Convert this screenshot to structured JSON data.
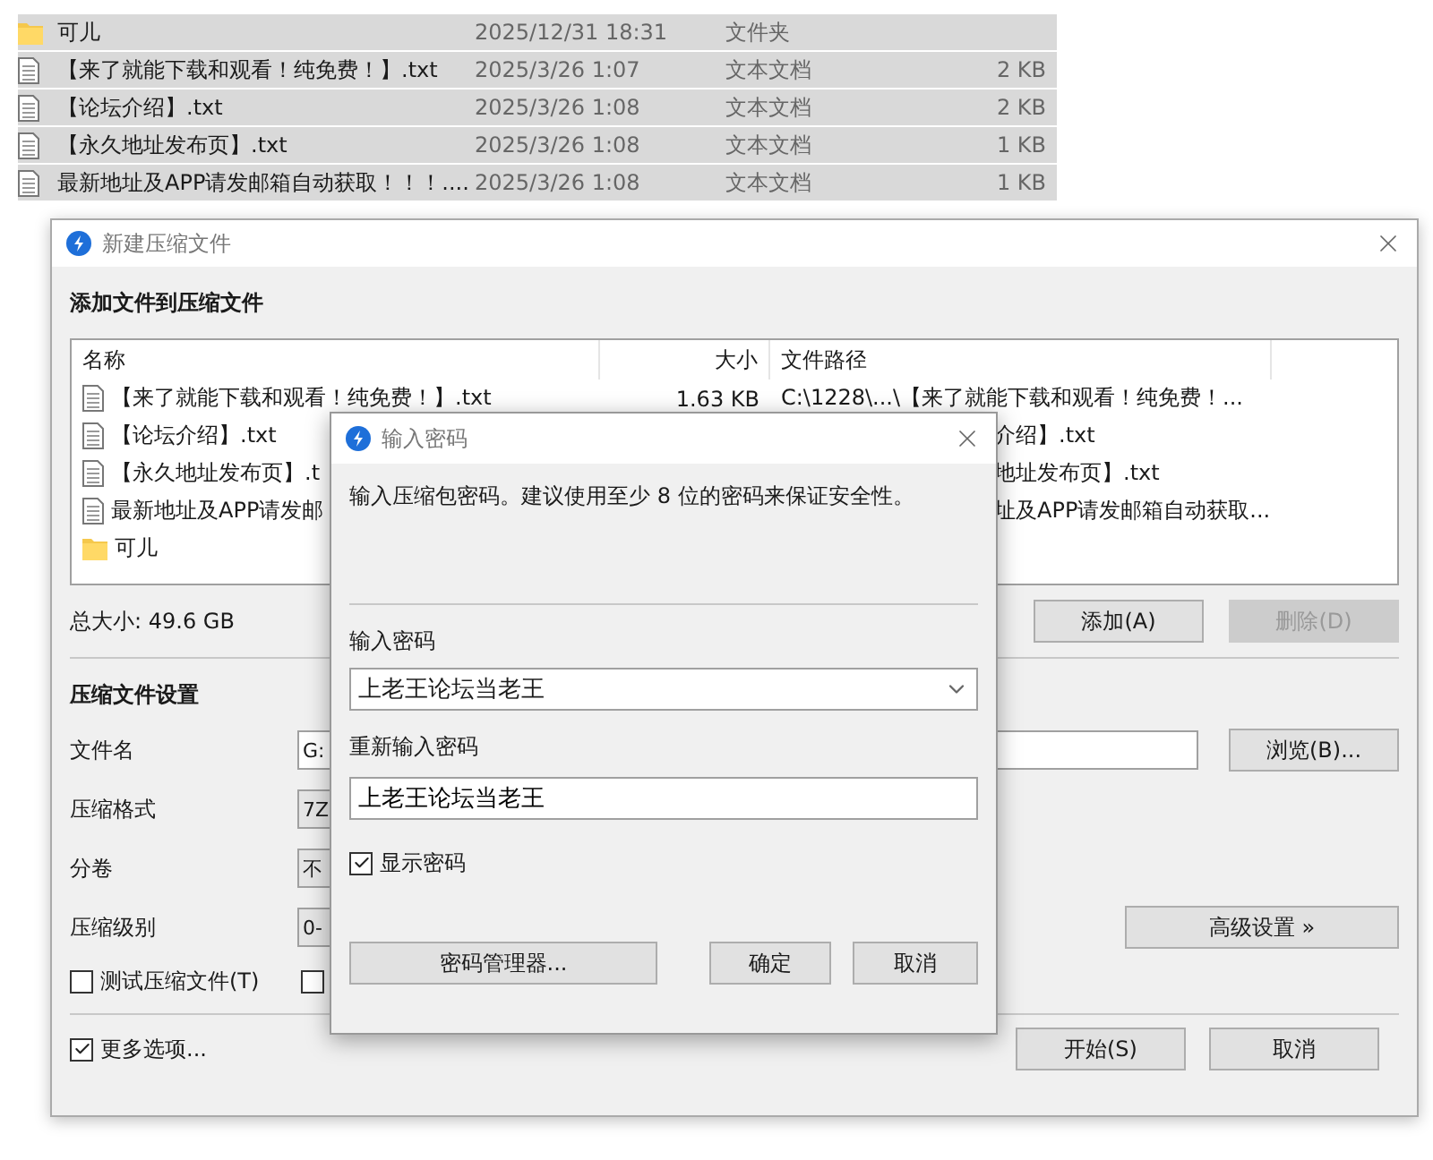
{
  "explorer_rows": [
    {
      "kind": "folder",
      "name": "可儿",
      "date": "2025/12/31 18:31",
      "type": "文件夹",
      "selected": true
    },
    {
      "kind": "text",
      "name": "【来了就能下载和观看！纯免费！】.txt",
      "date": "2025/3/26 1:07",
      "type": "文本文档",
      "size": "2 KB",
      "selected": true
    },
    {
      "kind": "text",
      "name": "【论坛介绍】.txt",
      "date": "2025/3/26 1:08",
      "type": "文本文档",
      "size": "2 KB",
      "selected": true
    },
    {
      "kind": "text",
      "name": "【永久地址发布页】.txt",
      "date": "2025/3/26 1:08",
      "type": "文本文档",
      "size": "1 KB",
      "selected": true
    },
    {
      "kind": "text",
      "name": "最新地址及APP请发邮箱自动获取！！！....",
      "date": "2025/3/26 1:08",
      "type": "文本文档",
      "size": "1 KB",
      "selected": true
    }
  ],
  "compress_dialog": {
    "title": "新建压缩文件",
    "heading": "添加文件到压缩文件",
    "columns": [
      "名称",
      "大小",
      "文件路径"
    ],
    "files": [
      {
        "kind": "text",
        "name": "【来了就能下载和观看！纯免费！】.txt",
        "size": "1.63 KB",
        "path": "C:\\1228\\...\\【来了就能下载和观看！纯免费！..."
      },
      {
        "kind": "text",
        "name": "【论坛介绍】.txt",
        "path": "介绍】.txt"
      },
      {
        "kind": "text",
        "name": "【永久地址发布页】.t",
        "path": "地址发布页】.txt"
      },
      {
        "kind": "text",
        "name": "最新地址及APP请发邮",
        "path": "址及APP请发邮箱自动获取..."
      },
      {
        "kind": "folder",
        "name": "可儿"
      }
    ],
    "total": "总大小: 49.6 GB",
    "add_button": {
      "label": "添加(A)",
      "disabled": false
    },
    "delete_button": {
      "label": "删除(D)",
      "disabled": true
    },
    "settings_heading": "压缩文件设置",
    "settings": [
      {
        "label": "文件名",
        "value": "G:",
        "kind": "wide",
        "button": "浏览(B)..."
      },
      {
        "label": "压缩格式",
        "value": "7Z",
        "kind": "narrow"
      },
      {
        "label": "分卷",
        "value": "不",
        "kind": "narrow"
      },
      {
        "label": "压缩级别",
        "value": "0-",
        "kind": "narrow",
        "button": "高级设置 »"
      }
    ],
    "options": [
      {
        "label": "测试压缩文件(T)",
        "checked": false
      },
      {
        "checked": false
      }
    ],
    "more_options": {
      "label": "更多选项...",
      "checked": true
    },
    "start_button": "开始(S)",
    "cancel_button": "取消"
  },
  "password_dialog": {
    "title": "输入密码",
    "message": "输入压缩包密码。建议使用至少 8 位的密码来保证安全性。",
    "password_label": "输入密码",
    "password_value": "上老王论坛当老王",
    "confirm_label": "重新输入密码",
    "confirm_value": "上老王论坛当老王",
    "show_password": {
      "label": "显示密码",
      "checked": true
    },
    "manager_button": "密码管理器...",
    "ok_button": "确定",
    "cancel_button": "取消"
  }
}
